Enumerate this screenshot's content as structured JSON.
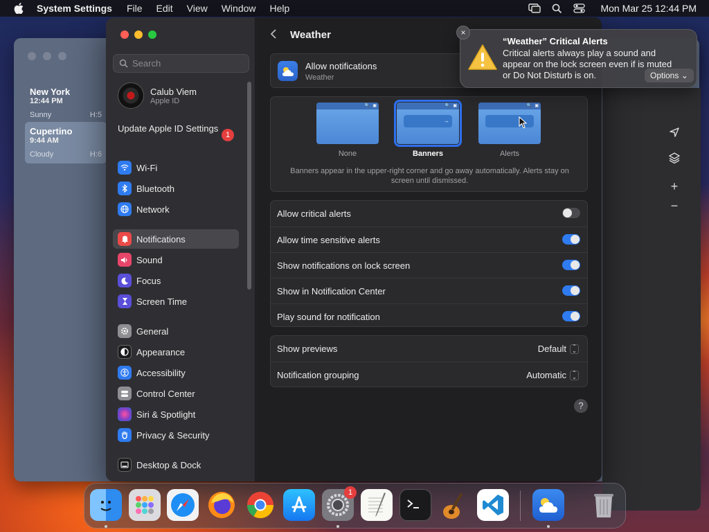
{
  "menubar": {
    "app_name": "System Settings",
    "menus": [
      "File",
      "Edit",
      "View",
      "Window",
      "Help"
    ],
    "clock": "Mon Mar 25  12:44 PM"
  },
  "weather_app": {
    "cities": [
      {
        "name": "New York",
        "time": "12:44 PM",
        "condition": "Sunny",
        "high": "H:5"
      },
      {
        "name": "Cupertino",
        "time": "9:44 AM",
        "condition": "Cloudy",
        "high": "H:6"
      }
    ]
  },
  "sidebar": {
    "search_placeholder": "Search",
    "account": {
      "name": "Calub Viem",
      "subtitle": "Apple ID"
    },
    "update": {
      "label": "Update Apple ID Settings",
      "badge": "1"
    },
    "items": [
      {
        "label": "Wi-Fi",
        "icon": "wifi-icon",
        "color": "#2f7bf0"
      },
      {
        "label": "Bluetooth",
        "icon": "bluetooth-icon",
        "color": "#2f7bf0"
      },
      {
        "label": "Network",
        "icon": "globe-icon",
        "color": "#2f7bf0"
      },
      {
        "label": "Notifications",
        "icon": "bell-icon",
        "color": "#ea4a48"
      },
      {
        "label": "Sound",
        "icon": "speaker-icon",
        "color": "#e8456a"
      },
      {
        "label": "Focus",
        "icon": "moon-icon",
        "color": "#5a4fd8"
      },
      {
        "label": "Screen Time",
        "icon": "hourglass-icon",
        "color": "#5a4fd8"
      },
      {
        "label": "General",
        "icon": "gear-icon",
        "color": "#8e8e93"
      },
      {
        "label": "Appearance",
        "icon": "appearance-icon",
        "color": "#1c1c1e"
      },
      {
        "label": "Accessibility",
        "icon": "accessibility-icon",
        "color": "#2f7bf0"
      },
      {
        "label": "Control Center",
        "icon": "control-center-icon",
        "color": "#8e8e93"
      },
      {
        "label": "Siri & Spotlight",
        "icon": "siri-icon",
        "color": "#7a3fc8"
      },
      {
        "label": "Privacy & Security",
        "icon": "hand-icon",
        "color": "#2f7bf0"
      },
      {
        "label": "Desktop & Dock",
        "icon": "dock-icon",
        "color": "#1c1c1e"
      }
    ]
  },
  "content": {
    "title": "Weather",
    "allow": {
      "label": "Allow notifications",
      "app": "Weather"
    },
    "styles": [
      {
        "label": "None",
        "selected": false
      },
      {
        "label": "Banners",
        "selected": true
      },
      {
        "label": "Alerts",
        "selected": false
      }
    ],
    "style_description": "Banners appear in the upper-right corner and go away automatically. Alerts stay on screen until dismissed.",
    "toggles": [
      {
        "label": "Allow critical alerts",
        "on": false
      },
      {
        "label": "Allow time sensitive alerts",
        "on": true
      },
      {
        "label": "Show notifications on lock screen",
        "on": true
      },
      {
        "label": "Show in Notification Center",
        "on": true
      },
      {
        "label": "Play sound for notification",
        "on": true
      }
    ],
    "selects": [
      {
        "label": "Show previews",
        "value": "Default"
      },
      {
        "label": "Notification grouping",
        "value": "Automatic"
      }
    ],
    "help": "?"
  },
  "notification": {
    "title": "“Weather” Critical Alerts",
    "body": "Critical alerts always play a sound and appear on the lock screen even if is muted or Do Not Disturb is on.",
    "options_label": "Options"
  },
  "dock": {
    "apps": [
      "Finder",
      "Launchpad",
      "Safari",
      "Firefox",
      "Chrome",
      "App Store",
      "System Settings",
      "TextEdit",
      "Terminal",
      "GarageBand",
      "Visual Studio Code",
      "Weather",
      "Trash"
    ],
    "settings_badge": "1"
  }
}
